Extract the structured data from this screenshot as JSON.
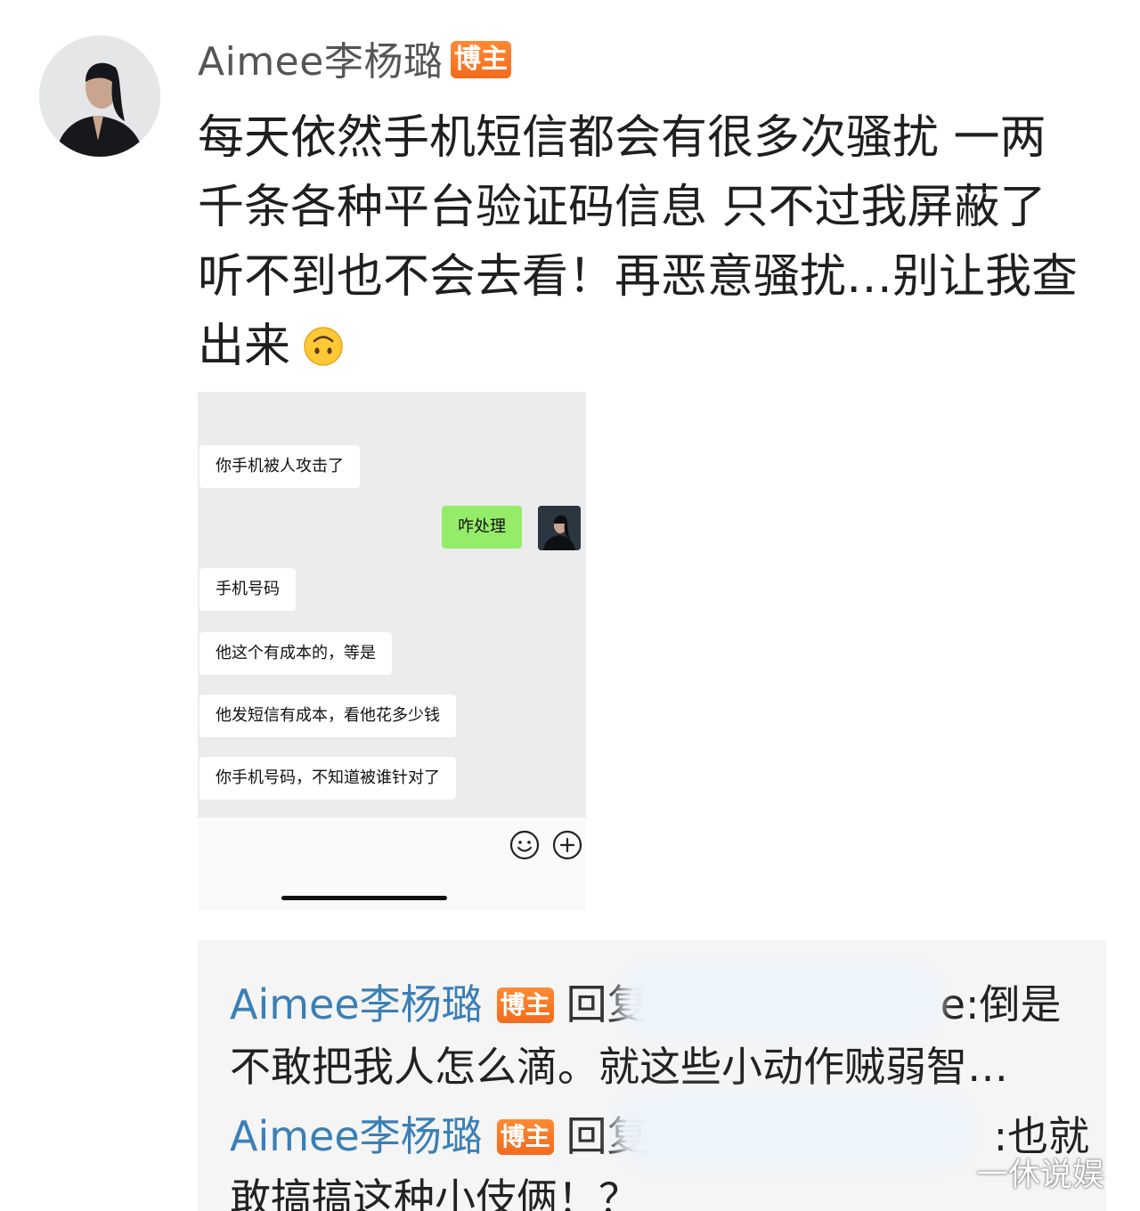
{
  "post": {
    "username": "Aimee李杨璐",
    "badge": "博主",
    "text_lines": [
      "每天依然手机短信都会有很多次骚扰 一两",
      "千条各种平台验证码信息 只不过我屏蔽了",
      "听不到也不会去看！再恶意骚扰…别让我查",
      "出来"
    ],
    "emoji": "upside-down-face-emoji"
  },
  "chat_screenshot": {
    "header": "",
    "messages": [
      {
        "side": "left",
        "text": "你手机被人攻击了"
      },
      {
        "side": "right",
        "text": "咋处理"
      },
      {
        "side": "left",
        "text": "手机号码"
      },
      {
        "side": "left",
        "text": "他这个有成本的，等是"
      },
      {
        "side": "left",
        "text": "他发短信有成本，看他花多少钱"
      },
      {
        "side": "left",
        "text": "你手机号码，不知道被谁针对了"
      }
    ],
    "icons": [
      "emoji-icon",
      "plus-circle-icon"
    ]
  },
  "replies": [
    {
      "username": "Aimee李杨璐",
      "badge": "博主",
      "verb": "回复",
      "tail": "e:倒是",
      "continuation": "不敢把我人怎么滴。就这些小动作贼弱智…"
    },
    {
      "username": "Aimee李杨璐",
      "badge": "博主",
      "verb": "回复",
      "tail": ":也就",
      "continuation": "敢搞搞这种小伎俩！？"
    }
  ],
  "watermark": "一休说娱",
  "colors": {
    "badge": "#f26b1d",
    "reply_name": "#3b7fb6",
    "me_bubble": "#95ec69"
  }
}
